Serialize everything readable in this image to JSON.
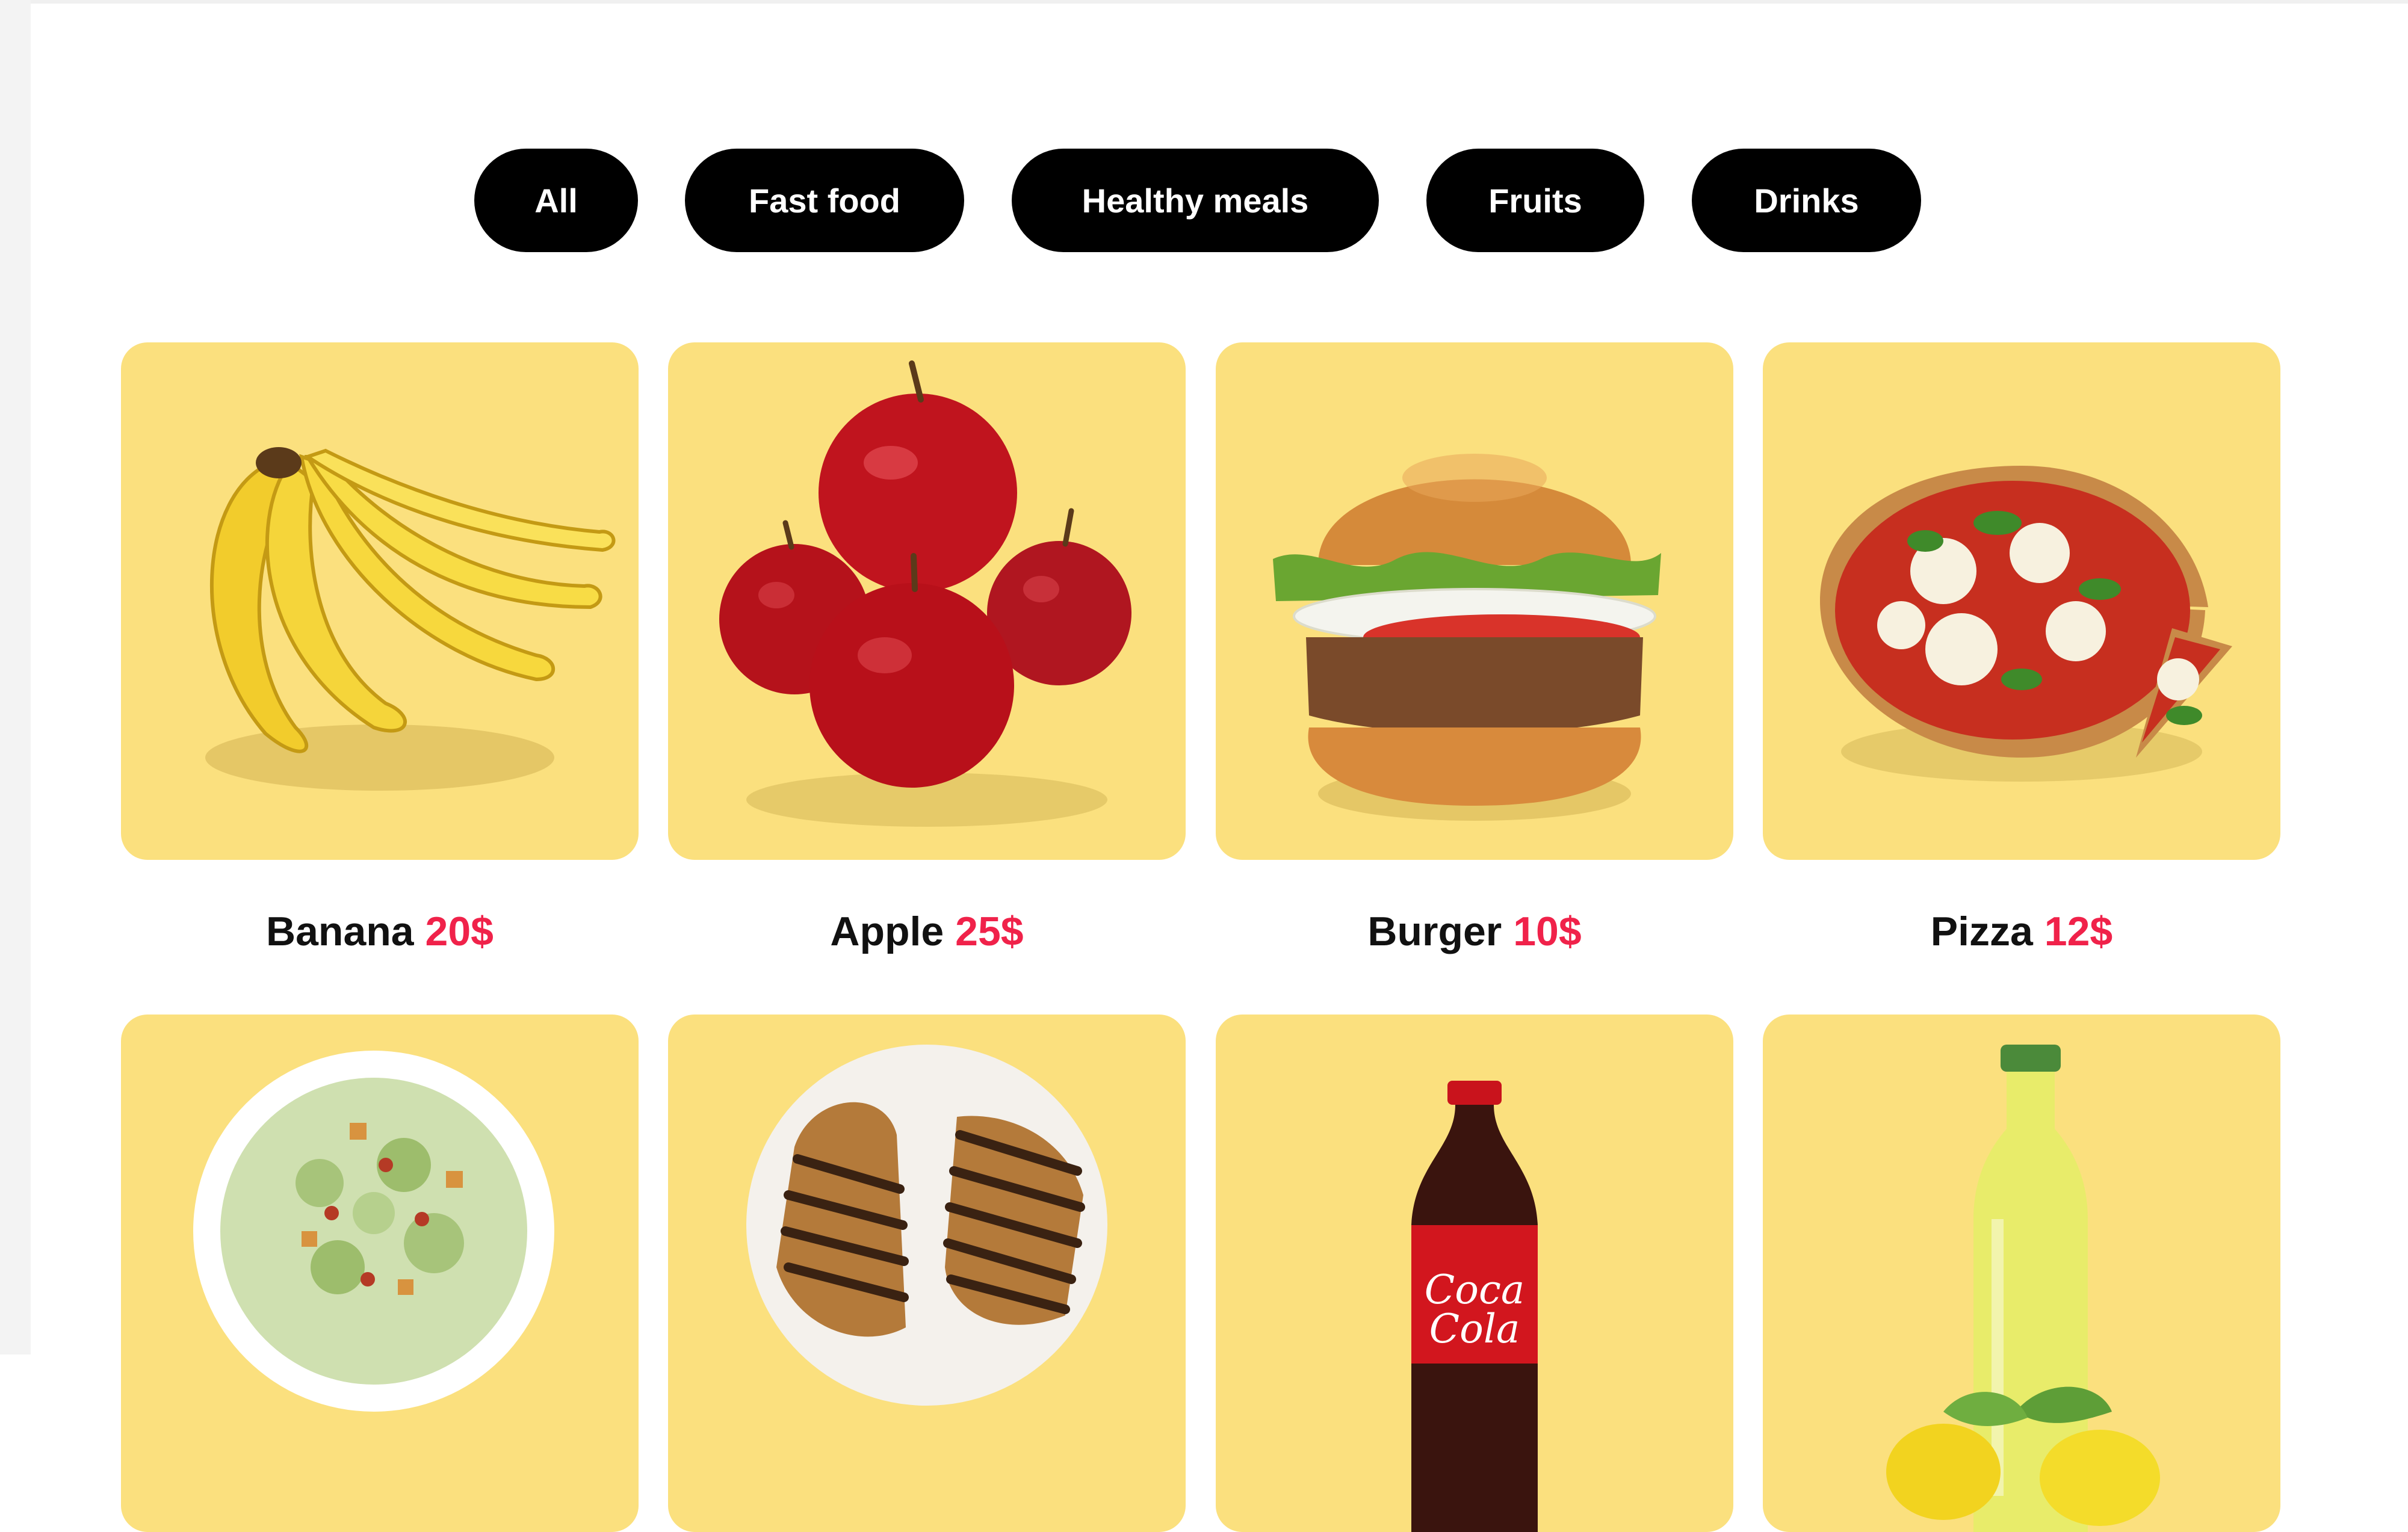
{
  "filters": [
    {
      "label": "All"
    },
    {
      "label": "Fast food"
    },
    {
      "label": "Healthy meals"
    },
    {
      "label": "Fruits"
    },
    {
      "label": "Drinks"
    }
  ],
  "products": [
    {
      "name": "Banana",
      "price": "20$",
      "image": "banana-bunch"
    },
    {
      "name": "Apple",
      "price": "25$",
      "image": "red-apples"
    },
    {
      "name": "Burger",
      "price": "10$",
      "image": "burger"
    },
    {
      "name": "Pizza",
      "price": "12$",
      "image": "pizza"
    },
    {
      "image": "caesar-salad"
    },
    {
      "image": "grilled-chicken"
    },
    {
      "image": "cola-bottle"
    },
    {
      "image": "lemonade-bottle"
    }
  ],
  "colors": {
    "card_background": "#fbe07e",
    "price": "#f0224a",
    "pill_background": "#000000",
    "pill_text": "#ffffff"
  }
}
